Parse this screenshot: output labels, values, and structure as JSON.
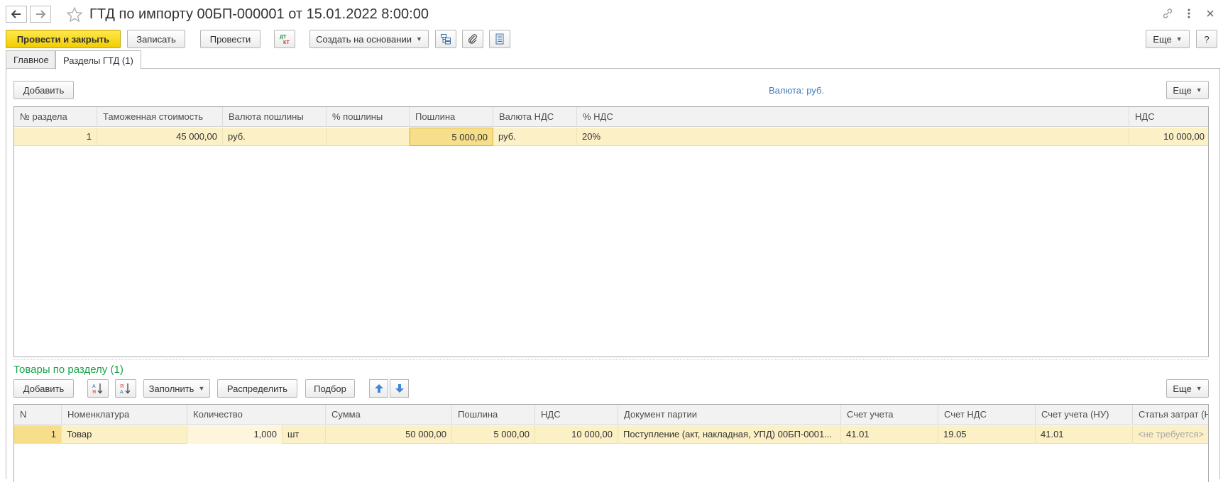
{
  "window": {
    "title": "ГТД по импорту 00БП-000001 от 15.01.2022 8:00:00"
  },
  "toolbar": {
    "post_close": "Провести и закрыть",
    "save": "Записать",
    "post": "Провести",
    "dt_kt": "Дт/Кт",
    "create_based_on": "Создать на основании",
    "more": "Еще",
    "help": "?"
  },
  "tabs": [
    {
      "label": "Главное",
      "active": false
    },
    {
      "label": "Разделы ГТД (1)",
      "active": true
    }
  ],
  "sections": {
    "add": "Добавить",
    "currency_label": "Валюта: руб.",
    "more": "Еще",
    "columns": [
      "№ раздела",
      "Таможенная стоимость",
      "Валюта пошлины",
      "% пошлины",
      "Пошлина",
      "Валюта НДС",
      "% НДС",
      "НДС"
    ],
    "rows": [
      {
        "num": "1",
        "customs_value": "45 000,00",
        "duty_currency": "руб.",
        "duty_pct": "",
        "duty": "5 000,00",
        "vat_currency": "руб.",
        "vat_pct": "20%",
        "vat": "10 000,00"
      }
    ]
  },
  "goods": {
    "title": "Товары по разделу (1)",
    "add": "Добавить",
    "fill": "Заполнить",
    "distribute": "Распределить",
    "pick": "Подбор",
    "more": "Еще",
    "columns": [
      "N",
      "Номенклатура",
      "Количество",
      "Сумма",
      "Пошлина",
      "НДС",
      "Документ партии",
      "Счет учета",
      "Счет НДС",
      "Счет учета (НУ)",
      "Статья затрат (НУ)"
    ],
    "rows": [
      {
        "n": "1",
        "item": "Товар",
        "qty": "1,000",
        "unit": "шт",
        "sum": "50 000,00",
        "duty": "5 000,00",
        "vat": "10 000,00",
        "batch_doc": "Поступление (акт, накладная, УПД) 00БП-0001...",
        "account": "41.01",
        "vat_account": "19.05",
        "account_nu": "41.01",
        "cost_item": "<не требуется>"
      }
    ]
  },
  "colors": {
    "primary_button": "#f5d40e",
    "row_selected": "#fbf0c6",
    "section_title": "#1aa34a",
    "link": "#3d7ab8"
  }
}
